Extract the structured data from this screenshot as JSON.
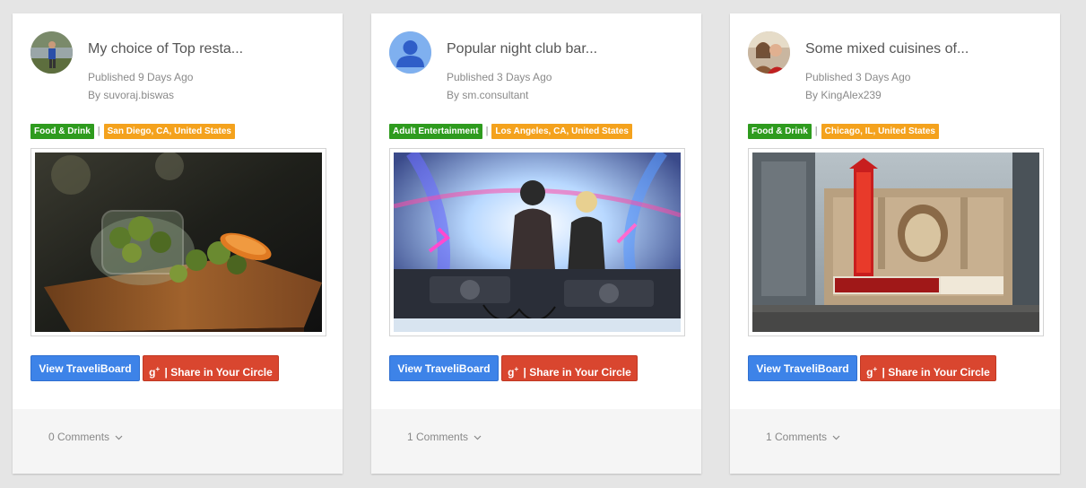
{
  "cards": [
    {
      "title": "My choice of Top resta...",
      "published": "Published 9 Days Ago",
      "author": "By suvoraj.biswas",
      "category": "Food & Drink",
      "location": "San Diego, CA, United States",
      "separator": "|",
      "view_label": "View TraveliBoard",
      "share_label": "| Share in Your Circle",
      "comments": "0 Comments",
      "photo_icon": "salad-jar-photo"
    },
    {
      "title": "Popular night club bar...",
      "published": "Published 3 Days Ago",
      "author": "By sm.consultant",
      "category": "Adult Entertainment",
      "location": "Los Angeles, CA, United States",
      "separator": "|",
      "view_label": "View TraveliBoard",
      "share_label": "| Share in Your Circle",
      "comments": "1 Comments",
      "photo_icon": "dj-nightclub-photo"
    },
    {
      "title": "Some mixed cuisines of...",
      "published": "Published 3 Days Ago",
      "author": "By KingAlex239",
      "category": "Food & Drink",
      "location": "Chicago, IL, United States",
      "separator": "|",
      "view_label": "View TraveliBoard",
      "share_label": "| Share in Your Circle",
      "comments": "1 Comments",
      "photo_icon": "chicago-theatre-photo"
    }
  ],
  "share_icon": "google-plus-icon",
  "colors": {
    "category_tag": "#2e9b1e",
    "location_tag": "#f4a21d",
    "view_button": "#3d83e8",
    "share_button": "#d9462f"
  }
}
